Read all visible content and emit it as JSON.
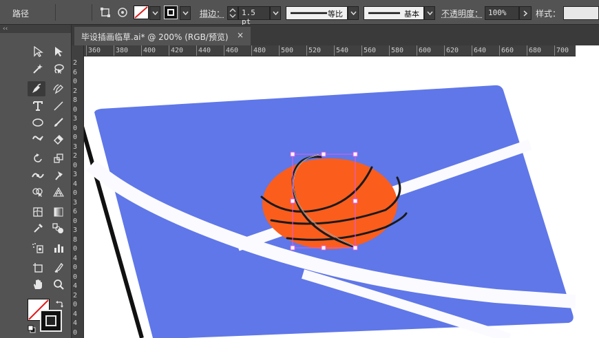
{
  "control_bar": {
    "object_type": "路径",
    "stroke_label": "描边：",
    "stroke_weight": "1.5 pt",
    "profile_1": "等比",
    "profile_2": "基本",
    "opacity_label": "不透明度：",
    "opacity_value": "100%",
    "style_label": "样式："
  },
  "document": {
    "tab_title": "毕设插画临草.ai* @ 200% (RGB/预览)",
    "close_glyph": "×"
  },
  "ruler": {
    "h_ticks": [
      "360",
      "380",
      "400",
      "420",
      "440",
      "460",
      "480",
      "500",
      "520",
      "540",
      "560",
      "580",
      "600",
      "620",
      "640",
      "660",
      "680",
      "700"
    ],
    "v_ticks": [
      "2",
      "6",
      "0",
      "2",
      "8",
      "0",
      "3",
      "0",
      "0",
      "3",
      "2",
      "0",
      "3",
      "4",
      "0",
      "3",
      "6",
      "0",
      "3",
      "8",
      "0",
      "4",
      "0",
      "0",
      "4",
      "2",
      "0",
      "4",
      "4",
      "0"
    ]
  },
  "colors": {
    "court_blue": "#5f77e8",
    "court_line": "#fbfaff",
    "ball_orange": "#fb5d1c",
    "seam": "#1a1a1a",
    "selection": "#e25ce8"
  },
  "tools_icons": [
    "selection-icon",
    "direct-selection-icon",
    "magic-wand-icon",
    "lasso-icon",
    "pen-icon",
    "curvature-icon",
    "type-icon",
    "line-icon",
    "ellipse-icon",
    "paintbrush-icon",
    "shaper-icon",
    "eraser-icon",
    "rotate-icon",
    "scale-icon",
    "width-icon",
    "puppet-warp-icon",
    "shape-builder-icon",
    "perspective-grid-icon",
    "mesh-icon",
    "gradient-icon",
    "eyedropper-icon",
    "blend-icon",
    "symbol-sprayer-icon",
    "column-graph-icon",
    "artboard-icon",
    "slice-icon",
    "hand-icon",
    "zoom-icon"
  ]
}
